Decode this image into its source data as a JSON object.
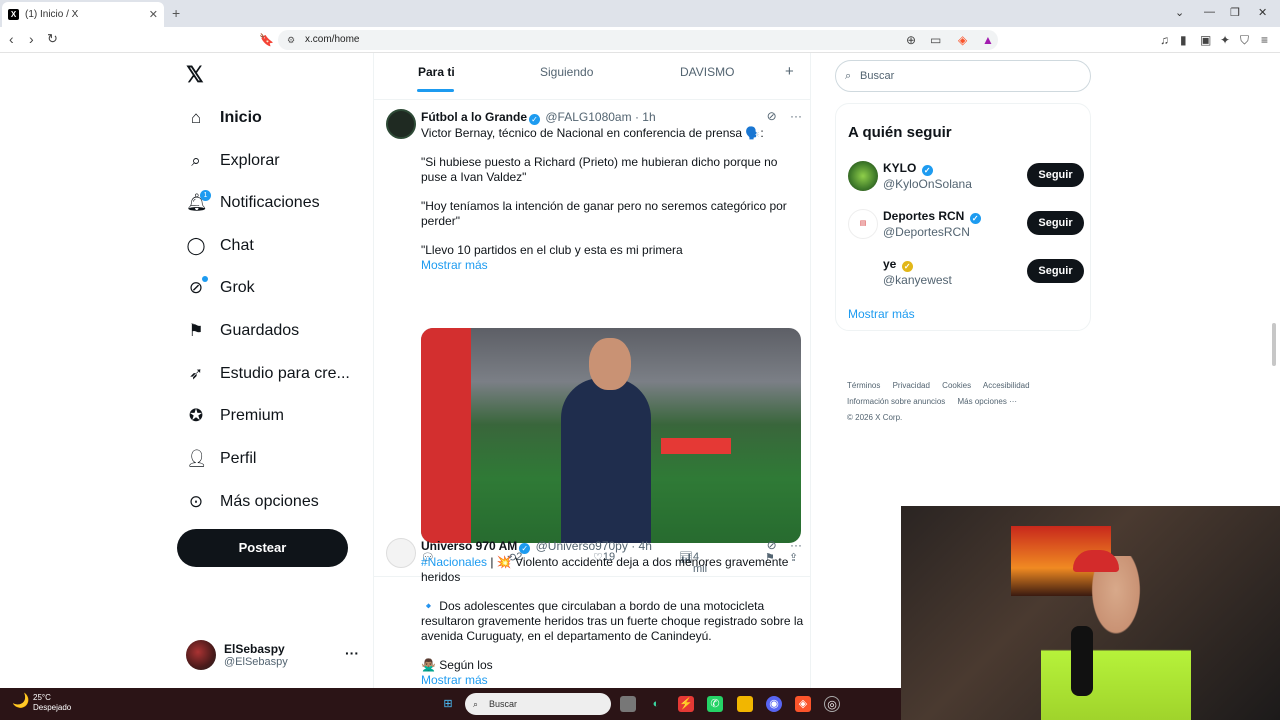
{
  "browser": {
    "tab_title": "(1) Inicio / X",
    "tab_favicon": "X",
    "url": "x.com/home",
    "icons": [
      "back-icon",
      "forward-icon",
      "reload-icon",
      "bookmark-icon",
      "zoom-icon",
      "cast-icon",
      "brave-shield-icon",
      "rewards-icon",
      "music-icon",
      "sidebar-icon",
      "wallet-icon",
      "leo-icon",
      "vpn-icon",
      "menu-icon"
    ]
  },
  "nav": {
    "logo": "𝕏",
    "items": [
      {
        "label": "Inicio",
        "icon": "home-icon"
      },
      {
        "label": "Explorar",
        "icon": "search-icon"
      },
      {
        "label": "Notificaciones",
        "icon": "bell-icon",
        "badge": "1"
      },
      {
        "label": "Chat",
        "icon": "chat-icon"
      },
      {
        "label": "Grok",
        "icon": "grok-icon"
      },
      {
        "label": "Guardados",
        "icon": "bookmark-icon"
      },
      {
        "label": "Estudio para cre...",
        "icon": "rocket-icon"
      },
      {
        "label": "Premium",
        "icon": "premium-icon"
      },
      {
        "label": "Perfil",
        "icon": "user-icon"
      },
      {
        "label": "Más opciones",
        "icon": "more-icon"
      }
    ],
    "post_button": "Postear",
    "account": {
      "name": "ElSebaspy",
      "handle": "@ElSebaspy"
    }
  },
  "feed": {
    "tabs": [
      "Para ti",
      "Siguiendo",
      "DAVISMO"
    ],
    "tweets": [
      {
        "name": "Fútbol a lo Grande",
        "handle": "@FALG1080am",
        "time": "1h",
        "lines": [
          "Victor Bernay, técnico de Nacional en conferencia de prensa 🗣️:",
          "\"Si hubiese puesto a Richard (Prieto) me hubieran dicho porque no puse a Ivan Valdez\"",
          "\"Hoy teníamos la intención de ganar pero no seremos categórico por perder\"",
          "\"Llevo 10 partidos en el club y esta es mi primera"
        ],
        "show_more": "Mostrar más",
        "replies": "",
        "retweets": "2",
        "likes": "19",
        "views": "4 mil"
      },
      {
        "name": "Universo 970 AM",
        "handle": "@Universo970py",
        "time": "4h",
        "hashtag": "#Nacionales",
        "lines": [
          " | 💥 Violento accidente deja a dos menores gravemente heridos",
          "🔹 Dos adolescentes que circulaban a bordo de una motocicleta resultaron gravemente heridos tras un fuerte choque registrado sobre la avenida Curuguaty, en el departamento de Canindeyú.",
          "🙅🏽‍♂️ Según los"
        ],
        "show_more": "Mostrar más"
      }
    ]
  },
  "sidebar": {
    "search_placeholder": "Buscar",
    "who_to_follow": "A quién seguir",
    "suggestions": [
      {
        "name": "KYLO",
        "handle": "@KyloOnSolana",
        "verified": "blue"
      },
      {
        "name": "Deportes RCN",
        "handle": "@DeportesRCN",
        "verified": "blue"
      },
      {
        "name": "ye",
        "handle": "@kanyewest",
        "verified": "gold"
      }
    ],
    "follow_label": "Seguir",
    "show_more": "Mostrar más",
    "footer": {
      "line1": [
        "Términos",
        "Privacidad",
        "Cookies",
        "Accesibilidad"
      ],
      "line2": [
        "Información sobre anuncios",
        "Más opciones ···"
      ],
      "copyright": "© 2026 X Corp."
    }
  },
  "taskbar": {
    "temp": "25°C",
    "condition": "Despejado",
    "search": "Buscar"
  },
  "colors": {
    "accent": "#1d9bf0",
    "text": "#0f1419",
    "muted": "#536471"
  }
}
